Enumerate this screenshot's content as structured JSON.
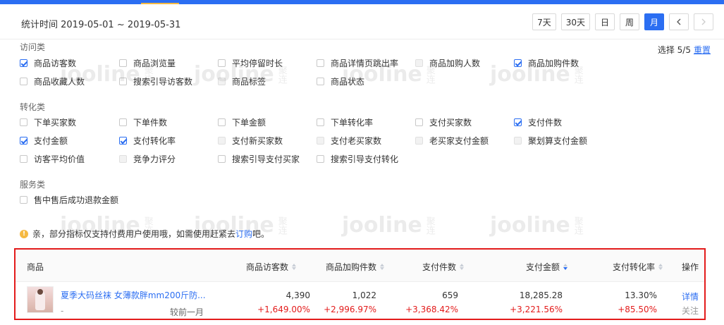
{
  "header": {
    "stat_time": "统计时间 2019-05-01 ~ 2019-05-31",
    "periods": [
      {
        "label": "7天",
        "active": false
      },
      {
        "label": "30天",
        "active": false
      },
      {
        "label": "日",
        "active": false
      },
      {
        "label": "周",
        "active": false
      },
      {
        "label": "月",
        "active": true
      }
    ],
    "prev_icon": "chevron-left-icon",
    "next_icon": "chevron-right-icon"
  },
  "selection": {
    "label": "选择 5/5",
    "reset": "重置"
  },
  "groups": {
    "visit": {
      "title": "访问类",
      "options": [
        {
          "label": "商品访客数",
          "state": "checked"
        },
        {
          "label": "商品浏览量",
          "state": "unchecked"
        },
        {
          "label": "平均停留时长",
          "state": "unchecked"
        },
        {
          "label": "商品详情页跳出率",
          "state": "unchecked"
        },
        {
          "label": "商品加购人数",
          "state": "disabled"
        },
        {
          "label": "商品加购件数",
          "state": "checked"
        },
        {
          "label": "商品收藏人数",
          "state": "unchecked"
        },
        {
          "label": "搜索引导访客数",
          "state": "unchecked"
        },
        {
          "label": "商品标签",
          "state": "disabled"
        },
        {
          "label": "商品状态",
          "state": "unchecked"
        }
      ]
    },
    "convert": {
      "title": "转化类",
      "options": [
        {
          "label": "下单买家数",
          "state": "unchecked"
        },
        {
          "label": "下单件数",
          "state": "unchecked"
        },
        {
          "label": "下单金额",
          "state": "unchecked"
        },
        {
          "label": "下单转化率",
          "state": "unchecked"
        },
        {
          "label": "支付买家数",
          "state": "unchecked"
        },
        {
          "label": "支付件数",
          "state": "checked"
        },
        {
          "label": "支付金额",
          "state": "checked"
        },
        {
          "label": "支付转化率",
          "state": "checked"
        },
        {
          "label": "支付新买家数",
          "state": "disabled"
        },
        {
          "label": "支付老买家数",
          "state": "disabled"
        },
        {
          "label": "老买家支付金额",
          "state": "disabled"
        },
        {
          "label": "聚划算支付金额",
          "state": "disabled"
        },
        {
          "label": "访客平均价值",
          "state": "unchecked"
        },
        {
          "label": "竞争力评分",
          "state": "disabled"
        },
        {
          "label": "搜索引导支付买家",
          "state": "unchecked"
        },
        {
          "label": "搜索引导支付转化",
          "state": "unchecked"
        }
      ]
    },
    "service": {
      "title": "服务类",
      "options": [
        {
          "label": "售中售后成功退款金额",
          "state": "unchecked"
        }
      ]
    }
  },
  "notice": {
    "icon": "warning-icon",
    "text": "亲，部分指标仅支持付费用户使用哦，如需使用赶紧去",
    "link": "订购",
    "tail": "吧。"
  },
  "table": {
    "headers": {
      "product": "商品",
      "visitors": "商品访客数",
      "cart": "商品加购件数",
      "pay_count": "支付件数",
      "pay_amount": "支付金额",
      "pay_rate": "支付转化率",
      "action": "操作"
    },
    "row": {
      "title": "夏季大码丝袜 女薄款胖mm200斤防...",
      "sub": "-",
      "compare_label": "较前一月",
      "visitors": "4,390",
      "visitors_delta": "+1,649.00%",
      "cart": "1,022",
      "cart_delta": "+2,996.97%",
      "pay_count": "659",
      "pay_count_delta": "+3,368.42%",
      "pay_amount": "18,285.28",
      "pay_amount_delta": "+3,221.56%",
      "pay_rate": "13.30%",
      "pay_rate_delta": "+85.50%",
      "detail": "详情",
      "follow": "关注"
    }
  },
  "watermark": {
    "latin": "jooline",
    "cn": "聚连"
  },
  "colors": {
    "accent": "#2b6ef2",
    "highlight_border": "#e31b1b",
    "delta": "#e31b1b",
    "tab_indicator": "#f5b942"
  }
}
